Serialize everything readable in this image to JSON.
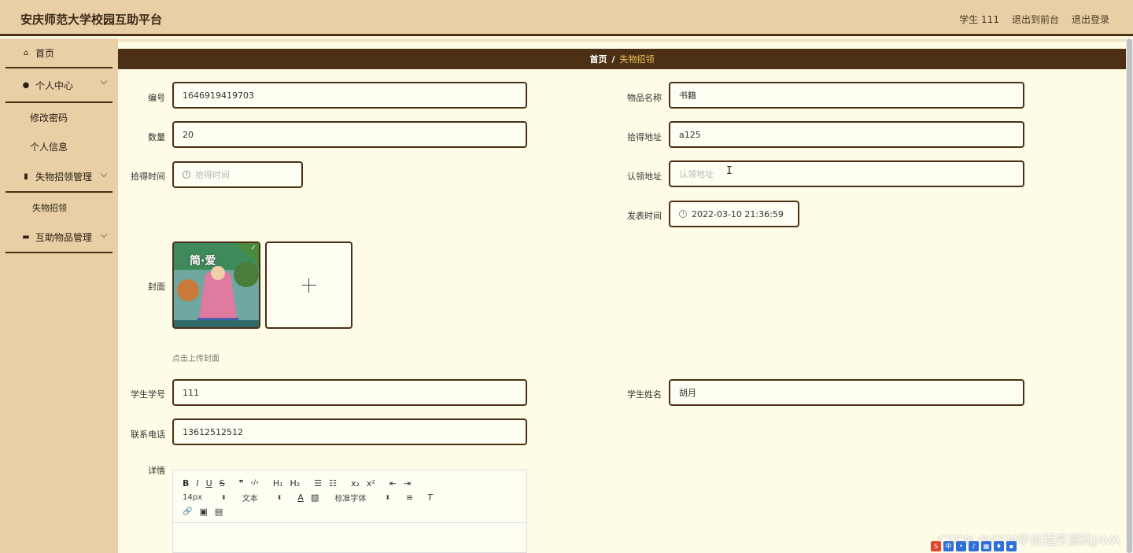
{
  "header": {
    "title": "安庆师范大学校园互助平台",
    "user": "学生 111",
    "back_to_front": "退出到前台",
    "logout": "退出登录"
  },
  "sidebar": {
    "items": [
      {
        "label": "首页",
        "icon": "home-icon"
      },
      {
        "label": "个人中心",
        "icon": "user-icon"
      },
      {
        "label": "修改密码"
      },
      {
        "label": "个人信息"
      },
      {
        "label": "失物招领管理",
        "icon": "book-icon"
      },
      {
        "label": "失物招领"
      },
      {
        "label": "互助物品管理",
        "icon": "box-icon"
      }
    ]
  },
  "breadcrumb": {
    "home": "首页",
    "separator": "/",
    "current": "失物招领"
  },
  "form": {
    "id_label": "编号",
    "id_value": "1646919419703",
    "item_name_label": "物品名称",
    "item_name_value": "书籍",
    "quantity_label": "数量",
    "quantity_value": "20",
    "found_address_label": "拾得地址",
    "found_address_value": "a125",
    "found_time_label": "拾得时间",
    "found_time_placeholder": "拾得时间",
    "claim_address_label": "认领地址",
    "claim_address_placeholder": "认领地址",
    "publish_time_label": "发表时间",
    "publish_time_value": "2022-03-10 21:36:59",
    "cover_label": "封面",
    "cover_upload_hint": "点击上传封面",
    "cover_image_title": "简·爱",
    "student_id_label": "学生学号",
    "student_id_value": "111",
    "student_name_label": "学生姓名",
    "student_name_value": "胡月",
    "phone_label": "联系电话",
    "phone_value": "13612512512",
    "details_label": "详情"
  },
  "editor_toolbar": {
    "row1": [
      "B",
      "I",
      "U",
      "S",
      "❞",
      "‹/›",
      "H₁",
      "H₂",
      "☰",
      "☷",
      "x₂",
      "x²",
      "⇤",
      "⇥"
    ],
    "font_size": "14px",
    "text_type": "文本",
    "font_family": "标准字体",
    "row3": [
      "🔗",
      "▣",
      "▤"
    ]
  },
  "watermark": "CSDN @SSM毕设程序源码JAVA",
  "colors": {
    "accent_dark": "#4b3016",
    "sidebar_bg": "#e9cfa6",
    "content_bg": "#fefbe6",
    "breadcrumb_current": "#f2c45a"
  }
}
